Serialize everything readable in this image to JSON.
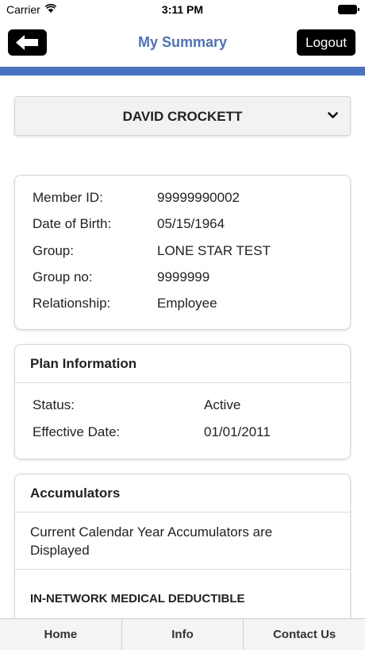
{
  "status_bar": {
    "carrier": "Carrier",
    "time": "3:11 PM"
  },
  "header": {
    "title": "My Summary",
    "logout_label": "Logout",
    "accent_color": "#4a72c2"
  },
  "member": {
    "name": "DAVID CROCKETT"
  },
  "member_info": {
    "rows": [
      {
        "label": "Member ID:",
        "value": "99999990002"
      },
      {
        "label": "Date of Birth:",
        "value": "05/15/1964"
      },
      {
        "label": "Group:",
        "value": "LONE STAR TEST"
      },
      {
        "label": "Group no:",
        "value": "9999999"
      },
      {
        "label": "Relationship:",
        "value": "Employee"
      }
    ]
  },
  "plan": {
    "title": "Plan Information",
    "rows": [
      {
        "label": "Status:",
        "value": "Active"
      },
      {
        "label": "Effective Date:",
        "value": "01/01/2011"
      }
    ]
  },
  "accumulators": {
    "title": "Accumulators",
    "description": "Current Calendar Year Accumulators are Displayed",
    "section_title": "IN-NETWORK MEDICAL DEDUCTIBLE"
  },
  "tabs": [
    {
      "label": "Home"
    },
    {
      "label": "Info"
    },
    {
      "label": "Contact Us"
    }
  ]
}
